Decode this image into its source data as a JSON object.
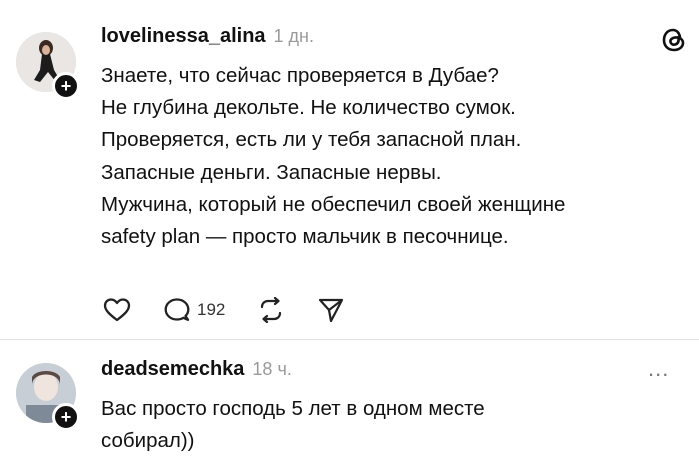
{
  "posts": [
    {
      "username": "lovelinessa_alina",
      "time": "1 дн.",
      "lines": [
        "Знаете, что сейчас проверяется в Дубае?",
        "Не глубина декольте. Не количество сумок.",
        "Проверяется, есть ли у тебя запасной план.",
        "Запасные деньги. Запасные нервы.",
        "Мужчина, который не обеспечил своей женщине",
        "safety plan — просто мальчик в песочнице."
      ],
      "reply_count": "192",
      "icons": {
        "like": "heart-icon",
        "reply": "comment-icon",
        "repost": "repost-icon",
        "share": "send-icon",
        "app": "threads-icon",
        "follow": "plus-icon"
      }
    },
    {
      "username": "deadsemechka",
      "time": "18 ч.",
      "more": "...",
      "lines": [
        "Вас просто господь 5 лет в одном месте",
        "собирал))"
      ],
      "icons": {
        "more": "more-icon",
        "follow": "plus-icon"
      }
    }
  ]
}
